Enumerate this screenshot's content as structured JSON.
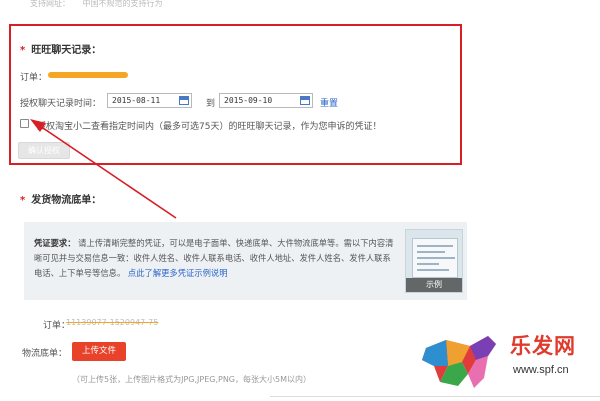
{
  "top_note": {
    "label": "支持网址：",
    "value": "中国不规范的支持行为"
  },
  "chat_section": {
    "star": "*",
    "title": "旺旺聊天记录：",
    "order_label": "订单：",
    "auth_time_label": "授权聊天记录时间：",
    "start_date": "2015-08-11",
    "to_text": "到",
    "end_date": "2015-09-10",
    "reset_label": "重置",
    "auth_text": "授权淘宝小二查看指定时间内（最多可选75天）的旺旺聊天记录，作为您申诉的凭证！",
    "confirm_label": "确认授权"
  },
  "logistics_section": {
    "star": "*",
    "title": "发货物流底单：",
    "proof_title": "凭证要求：",
    "proof_body": "请上传清晰完整的凭证，可以是电子面单、快递底单、大件物流底单等。需以下内容清晰可见并与交易信息一致：收件人姓名、收件人联系电话、收件人地址、发件人姓名、发件人联系电话、上下单号等信息。",
    "proof_link": "点此了解更多凭证示例说明",
    "example_label": "示例",
    "order_label": "订单：",
    "order_value": "11139077-1520947-75",
    "waybill_label": "物流底单：",
    "upload_label": "上传文件",
    "hint": "（可上传5张，上传图片格式为JPG,JPEG,PNG，每张大小5M以内）"
  },
  "logo": {
    "text": "乐发网",
    "url": "www.spf.cn"
  },
  "colors": {
    "highlight_border": "#d71f26",
    "link": "#2a64c8",
    "upload": "#e8422b",
    "scribble": "#f5a623"
  }
}
